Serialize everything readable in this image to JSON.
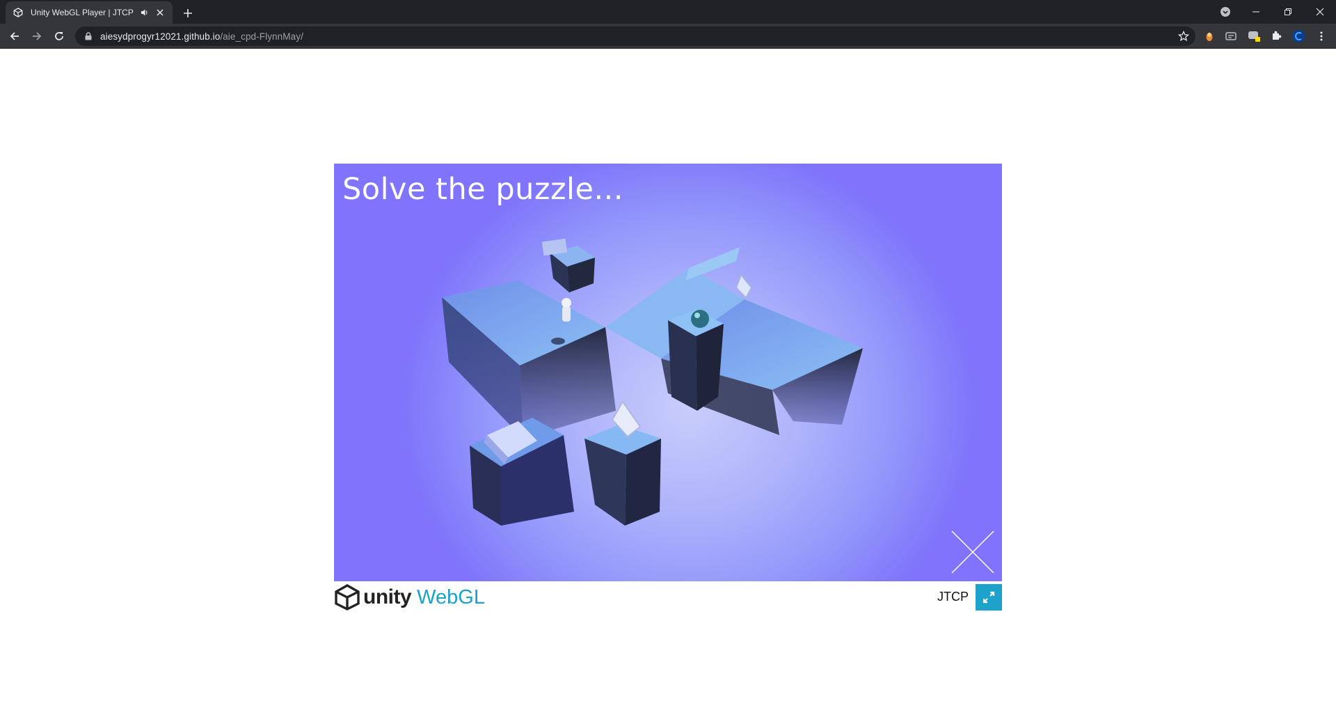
{
  "browser": {
    "tab_title": "Unity WebGL Player | JTCP",
    "url_host": "aiesydprogyr12021.github.io",
    "url_path": "/aie_cpd-FlynnMay/"
  },
  "game": {
    "overlay_text": "Solve the puzzle..."
  },
  "footer": {
    "logo_word": "unity",
    "logo_webgl": "WebGL",
    "build_title": "JTCP"
  },
  "colors": {
    "canvas_bg": "#7b72fa",
    "accent": "#1ca2cb",
    "chrome_dark": "#202124",
    "chrome_mid": "#35363a"
  },
  "icons": [
    "unity-favicon-icon",
    "speaker-icon",
    "close-icon",
    "plus-icon",
    "back-icon",
    "forward-icon",
    "reload-icon",
    "lock-icon",
    "star-icon",
    "extension-icon",
    "puzzle-icon",
    "fullscreen-icon"
  ]
}
